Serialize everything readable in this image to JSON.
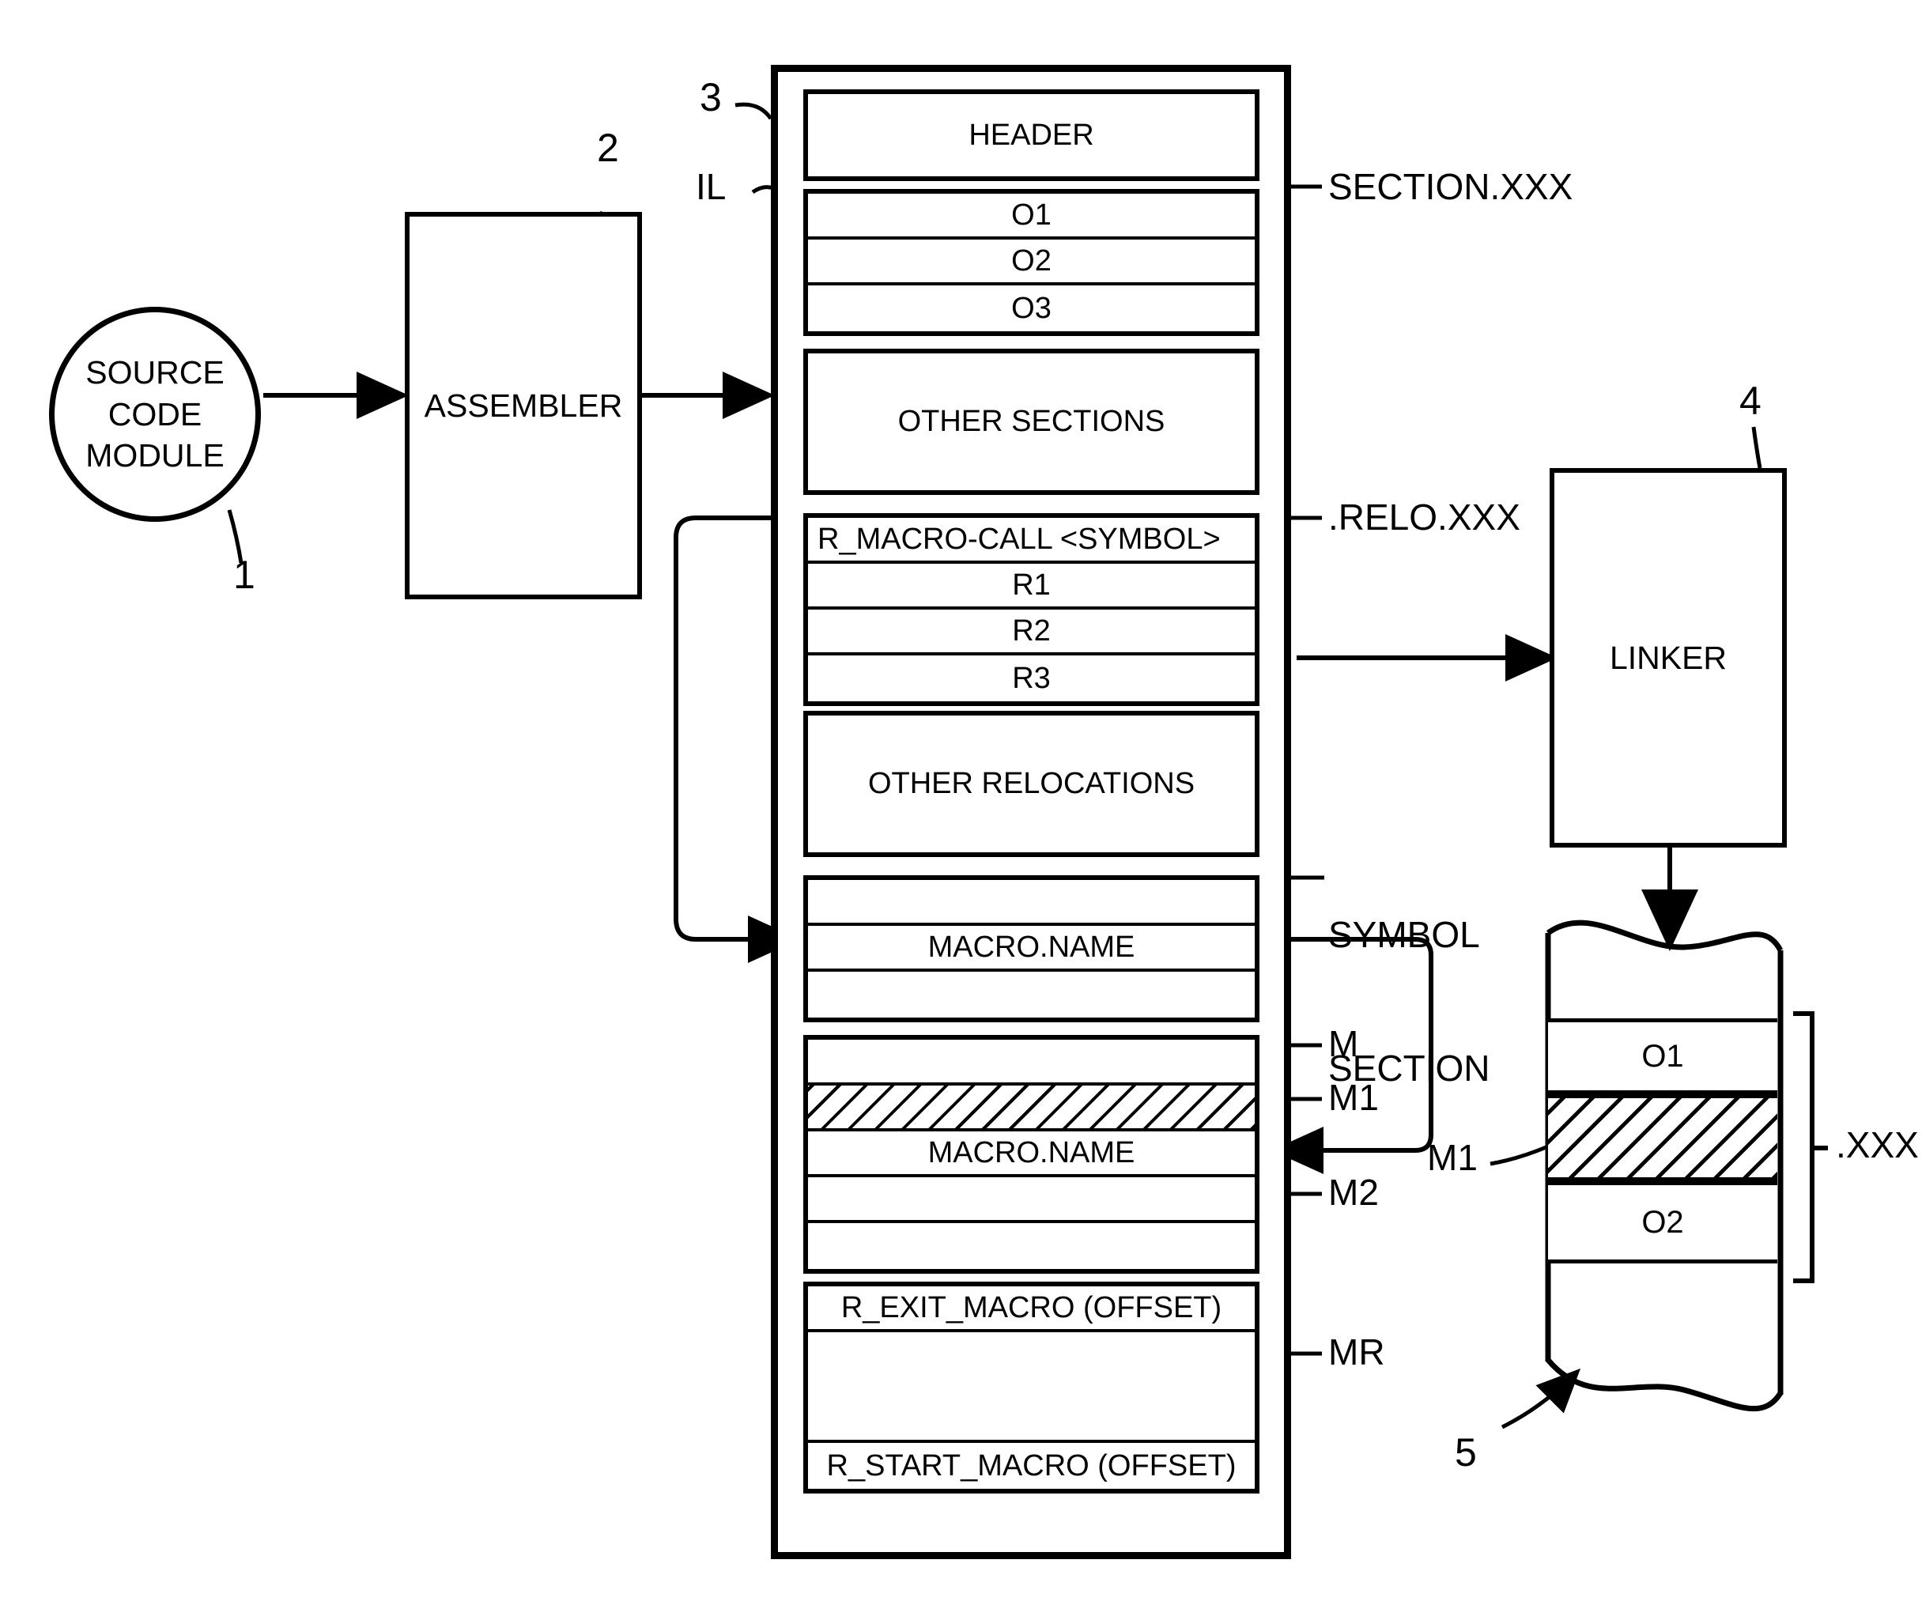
{
  "figure": {
    "source_module": {
      "lines": [
        "SOURCE",
        "CODE",
        "MODULE"
      ],
      "ref": "1"
    },
    "assembler": {
      "label": "ASSEMBLER",
      "ref": "2"
    },
    "linker": {
      "label": "LINKER",
      "ref": "4"
    },
    "object_file": {
      "ref": "3",
      "il_label": "IL",
      "groups": [
        {
          "name": "header-group",
          "rows": [
            {
              "text": "HEADER",
              "style": "tall"
            }
          ]
        },
        {
          "name": "section-group",
          "right_label": "SECTION.XXX",
          "rows": [
            {
              "text": "O1",
              "style": "normal"
            },
            {
              "text": "O2",
              "style": "normal"
            },
            {
              "text": "O3",
              "style": "normal"
            }
          ]
        },
        {
          "name": "other-sections-group",
          "rows": [
            {
              "text": "OTHER SECTIONS",
              "style": "tall"
            }
          ]
        },
        {
          "name": "relo-group",
          "right_label": ".RELO.XXX",
          "rows": [
            {
              "text": "R_MACRO-CALL <SYMBOL>",
              "style": "left"
            },
            {
              "text": "R1",
              "style": "normal"
            },
            {
              "text": "R2",
              "style": "normal"
            },
            {
              "text": "R3",
              "style": "normal"
            }
          ]
        },
        {
          "name": "other-relocations-group",
          "rows": [
            {
              "text": "OTHER RELOCATIONS",
              "style": "tall"
            }
          ]
        },
        {
          "name": "symbol-section-group",
          "right_label": "SYMBOL\nSECTION",
          "rows": [
            {
              "text": "",
              "style": "normal"
            },
            {
              "text": "MACRO.NAME",
              "style": "normal"
            },
            {
              "text": "",
              "style": "normal"
            }
          ]
        },
        {
          "name": "macro-group",
          "rows": [
            {
              "text": "",
              "style": "normal",
              "tag": "M"
            },
            {
              "text": "",
              "style": "hatch",
              "tag": "M1"
            },
            {
              "text": "MACRO.NAME",
              "style": "normal"
            },
            {
              "text": "",
              "style": "normal",
              "tag": "M2"
            },
            {
              "text": "",
              "style": "normal"
            }
          ]
        },
        {
          "name": "macro-relocation-group",
          "right_label": "MR",
          "rows": [
            {
              "text": "R_EXIT_MACRO (OFFSET)",
              "style": "normal"
            },
            {
              "text": "",
              "style": "tall"
            },
            {
              "text": "R_START_MACRO (OFFSET)",
              "style": "normal"
            }
          ]
        }
      ],
      "callout_tags": {
        "m": "M",
        "m1": "M1",
        "m2": "M2",
        "mr": "MR"
      }
    },
    "linker_output": {
      "ref": "5",
      "bracket_label": ".XXX",
      "m1_label": "M1",
      "rows": [
        {
          "text": "",
          "style": "normal"
        },
        {
          "text": "O1",
          "style": "normal"
        },
        {
          "text": "",
          "style": "hatch"
        },
        {
          "text": "O2",
          "style": "normal"
        },
        {
          "text": "",
          "style": "normal"
        }
      ]
    }
  },
  "colors": {
    "ink": "#000000",
    "paper": "#ffffff"
  }
}
